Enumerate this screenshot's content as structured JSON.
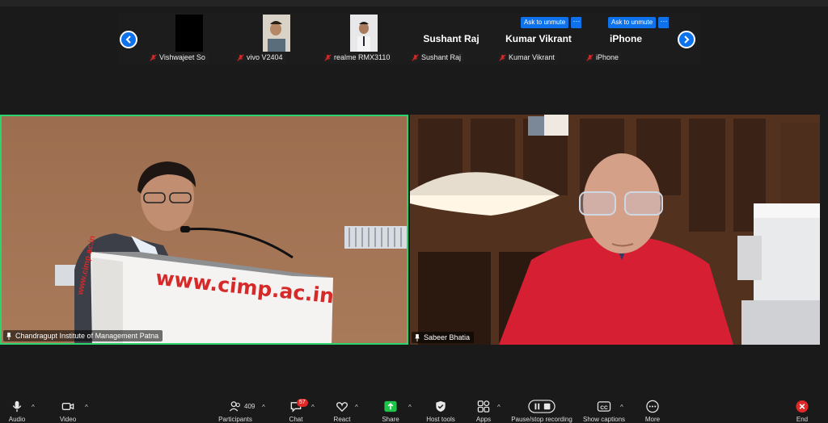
{
  "strip": {
    "participants": [
      {
        "label": "Vishwajeet So"
      },
      {
        "label": "vivo V2404"
      },
      {
        "label": "realme RMX3110"
      },
      {
        "label": "Sushant Raj",
        "name": "Sushant Raj"
      },
      {
        "label": "Kumar Vikrant",
        "name": "Kumar Vikrant",
        "unmute": "Ask to unmute",
        "more": "···"
      },
      {
        "label": "iPhone",
        "name": "iPhone",
        "unmute": "Ask to unmute",
        "more": "···"
      }
    ]
  },
  "videos": [
    {
      "label": "Chandragupt Institute of Management Patna",
      "podium_text": "www.cimp.ac.in",
      "podium_side": "www.cimp.ac.in"
    },
    {
      "label": "Sabeer Bhatia"
    }
  ],
  "toolbar": {
    "audio": "Audio",
    "video": "Video",
    "participants": "Participants",
    "participants_count": "409",
    "chat": "Chat",
    "chat_badge": "57",
    "react": "React",
    "share": "Share",
    "host_tools": "Host tools",
    "apps": "Apps",
    "recording": "Pause/stop recording",
    "captions": "Show captions",
    "more": "More",
    "end": "End"
  },
  "colors": {
    "accent": "#0e72ed",
    "active_speaker": "#2dd36f",
    "share": "#1ec34a",
    "end": "#e02828"
  }
}
